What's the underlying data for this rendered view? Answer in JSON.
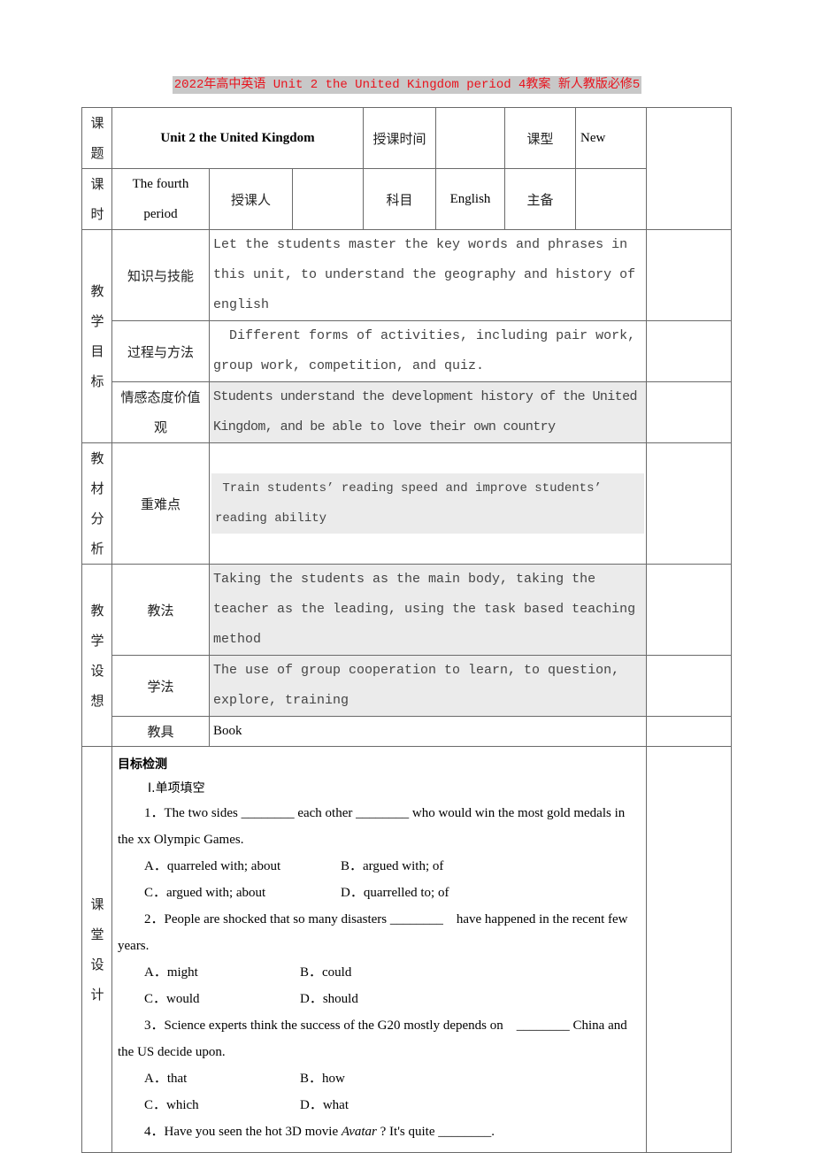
{
  "document": {
    "title": "2022年高中英语 Unit 2 the United Kingdom period 4教案 新人教版必修5"
  },
  "header": {
    "topic_label": "课题",
    "topic_value": "Unit 2 the United Kingdom",
    "teach_time_label": "授课时间",
    "teach_time_value": "",
    "lesson_type_label": "课型",
    "lesson_type_value": "New",
    "period_label": "课时",
    "period_value": "The fourth period",
    "teacher_label": "授课人",
    "teacher_value": "",
    "subject_label": "科目",
    "subject_value": "English",
    "main_prep_label": "主备",
    "main_prep_value": ""
  },
  "objectives": {
    "section_label": "教学目标",
    "rows": [
      {
        "label": "知识与技能",
        "text": "Let the students master the key words and phrases in this unit, to understand the geography and history of english"
      },
      {
        "label": "过程与方法",
        "text": "  Different forms of activities, including pair work, group work, competition, and quiz."
      },
      {
        "label": "情感态度价值观",
        "text": "Students understand the development history of the United Kingdom, and be able to love their own country"
      }
    ]
  },
  "analysis": {
    "section_label": "教材分析",
    "label": "重难点",
    "text": " Train students’ reading speed and improve students’ reading ability"
  },
  "design": {
    "section_label": "教学设想",
    "rows": [
      {
        "label": "教法",
        "text": "Taking the students as the main body, taking the teacher as the leading, using the task based teaching method"
      },
      {
        "label": "学法",
        "text": "The use of group cooperation to learn, to question, explore, training"
      },
      {
        "label": "教具",
        "text": "Book"
      }
    ]
  },
  "classroom": {
    "section_label": "课堂设计",
    "heading": "目标检测",
    "subheading": "Ⅰ.单项填空",
    "questions": [
      {
        "stem": "1．The two sides ________ each other ________ who would win the most gold medals in the xx Olympic Games.",
        "options": [
          "A．quarreled with; about",
          "B．argued with; of",
          "C．argued with; about",
          "D．quarrelled to; of"
        ]
      },
      {
        "stem": "2．People are shocked that so many disasters ________    have happened in the recent few years.",
        "options": [
          "A．might",
          "B．could",
          "C．would",
          "D．should"
        ]
      },
      {
        "stem": "3．Science experts think the success of the G20 mostly depends on    ________ China and the US decide upon.",
        "options": [
          "A．that",
          "B．how",
          "C．which",
          "D．what"
        ]
      },
      {
        "stem_before": "4．Have you seen the hot 3D movie ",
        "stem_italic": "Avatar",
        "stem_after": " ? It's quite ________."
      }
    ]
  }
}
